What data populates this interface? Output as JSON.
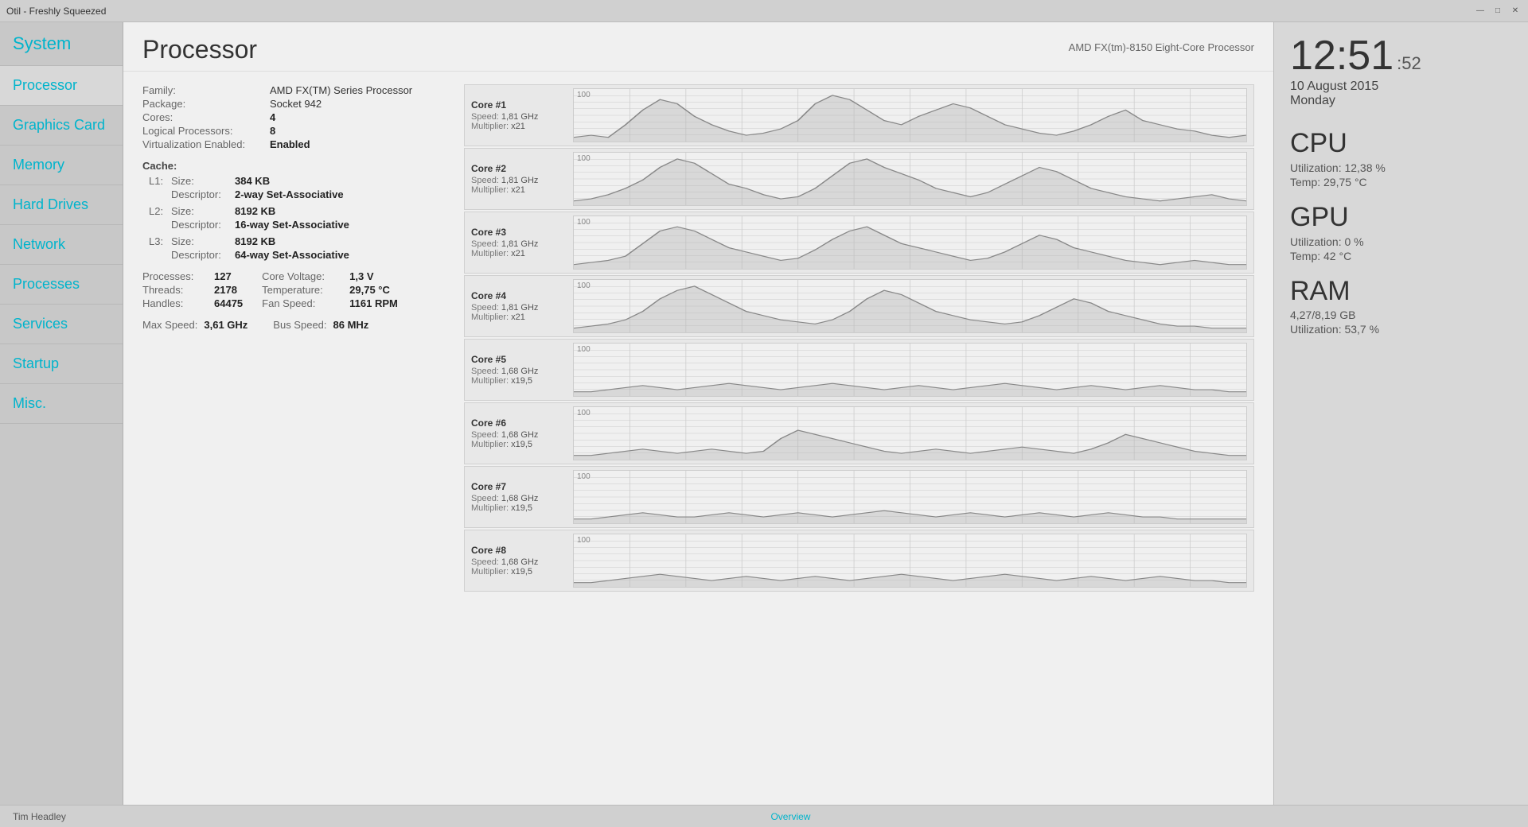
{
  "window": {
    "title": "Otil - Freshly Squeezed",
    "controls": [
      "—",
      "□",
      "✕"
    ]
  },
  "sidebar": {
    "items": [
      {
        "label": "System",
        "id": "system",
        "active": false
      },
      {
        "label": "Processor",
        "id": "processor",
        "active": true
      },
      {
        "label": "Graphics Card",
        "id": "graphics-card",
        "active": false
      },
      {
        "label": "Memory",
        "id": "memory",
        "active": false
      },
      {
        "label": "Hard Drives",
        "id": "hard-drives",
        "active": false
      },
      {
        "label": "Network",
        "id": "network",
        "active": false
      },
      {
        "label": "Processes",
        "id": "processes",
        "active": false
      },
      {
        "label": "Services",
        "id": "services",
        "active": false
      },
      {
        "label": "Startup",
        "id": "startup",
        "active": false
      },
      {
        "label": "Misc.",
        "id": "misc",
        "active": false
      }
    ]
  },
  "content": {
    "title": "Processor",
    "subtitle": "AMD FX(tm)-8150 Eight-Core Processor",
    "info": {
      "family_label": "Family:",
      "family_value": "AMD FX(TM) Series Processor",
      "package_label": "Package:",
      "package_value": "Socket 942",
      "cores_label": "Cores:",
      "cores_value": "4",
      "logical_label": "Logical Processors:",
      "logical_value": "8",
      "virt_label": "Virtualization Enabled:",
      "virt_value": "Enabled",
      "cache_title": "Cache:",
      "l1_size_label": "Size:",
      "l1_size_value": "384 KB",
      "l1_desc_label": "Descriptor:",
      "l1_desc_value": "2-way Set-Associative",
      "l2_size_label": "Size:",
      "l2_size_value": "8192 KB",
      "l2_desc_label": "Descriptor:",
      "l2_desc_value": "16-way Set-Associative",
      "l3_size_label": "Size:",
      "l3_size_value": "8192 KB",
      "l3_desc_label": "Descriptor:",
      "l3_desc_value": "64-way Set-Associative",
      "processes_label": "Processes:",
      "processes_value": "127",
      "threads_label": "Threads:",
      "threads_value": "2178",
      "handles_label": "Handles:",
      "handles_value": "64475",
      "core_voltage_label": "Core Voltage:",
      "core_voltage_value": "1,3 V",
      "temperature_label": "Temperature:",
      "temperature_value": "29,75 °C",
      "fan_speed_label": "Fan Speed:",
      "fan_speed_value": "1161 RPM",
      "max_speed_label": "Max Speed:",
      "max_speed_value": "3,61 GHz",
      "bus_speed_label": "Bus Speed:",
      "bus_speed_value": "86 MHz"
    },
    "cores": [
      {
        "name": "Core #1",
        "speed_label": "Speed:",
        "speed": "1,81 GHz",
        "mult_label": "Multiplier:",
        "mult": "x21"
      },
      {
        "name": "Core #2",
        "speed_label": "Speed:",
        "speed": "1,81 GHz",
        "mult_label": "Multiplier:",
        "mult": "x21"
      },
      {
        "name": "Core #3",
        "speed_label": "Speed:",
        "speed": "1,81 GHz",
        "mult_label": "Multiplier:",
        "mult": "x21"
      },
      {
        "name": "Core #4",
        "speed_label": "Speed:",
        "speed": "1,81 GHz",
        "mult_label": "Multiplier:",
        "mult": "x21"
      },
      {
        "name": "Core #5",
        "speed_label": "Speed:",
        "speed": "1,68 GHz",
        "mult_label": "Multiplier:",
        "mult": "x19,5"
      },
      {
        "name": "Core #6",
        "speed_label": "Speed:",
        "speed": "1,68 GHz",
        "mult_label": "Multiplier:",
        "mult": "x19,5"
      },
      {
        "name": "Core #7",
        "speed_label": "Speed:",
        "speed": "1,68 GHz",
        "mult_label": "Multiplier:",
        "mult": "x19,5"
      },
      {
        "name": "Core #8",
        "speed_label": "Speed:",
        "speed": "1,68 GHz",
        "mult_label": "Multiplier:",
        "mult": "x19,5"
      }
    ],
    "graph_label": "100"
  },
  "right_panel": {
    "time_main": "12:51",
    "time_seconds": ":52",
    "date": "10 August 2015",
    "day": "Monday",
    "cpu_title": "CPU",
    "cpu_util": "Utilization: 12,38 %",
    "cpu_temp": "Temp: 29,75 °C",
    "gpu_title": "GPU",
    "gpu_util": "Utilization: 0 %",
    "gpu_temp": "Temp: 42 °C",
    "ram_title": "RAM",
    "ram_amount": "4,27/8,19 GB",
    "ram_util": "Utilization: 53,7 %"
  },
  "footer": {
    "left": "Tim Headley",
    "center": "Overview"
  }
}
